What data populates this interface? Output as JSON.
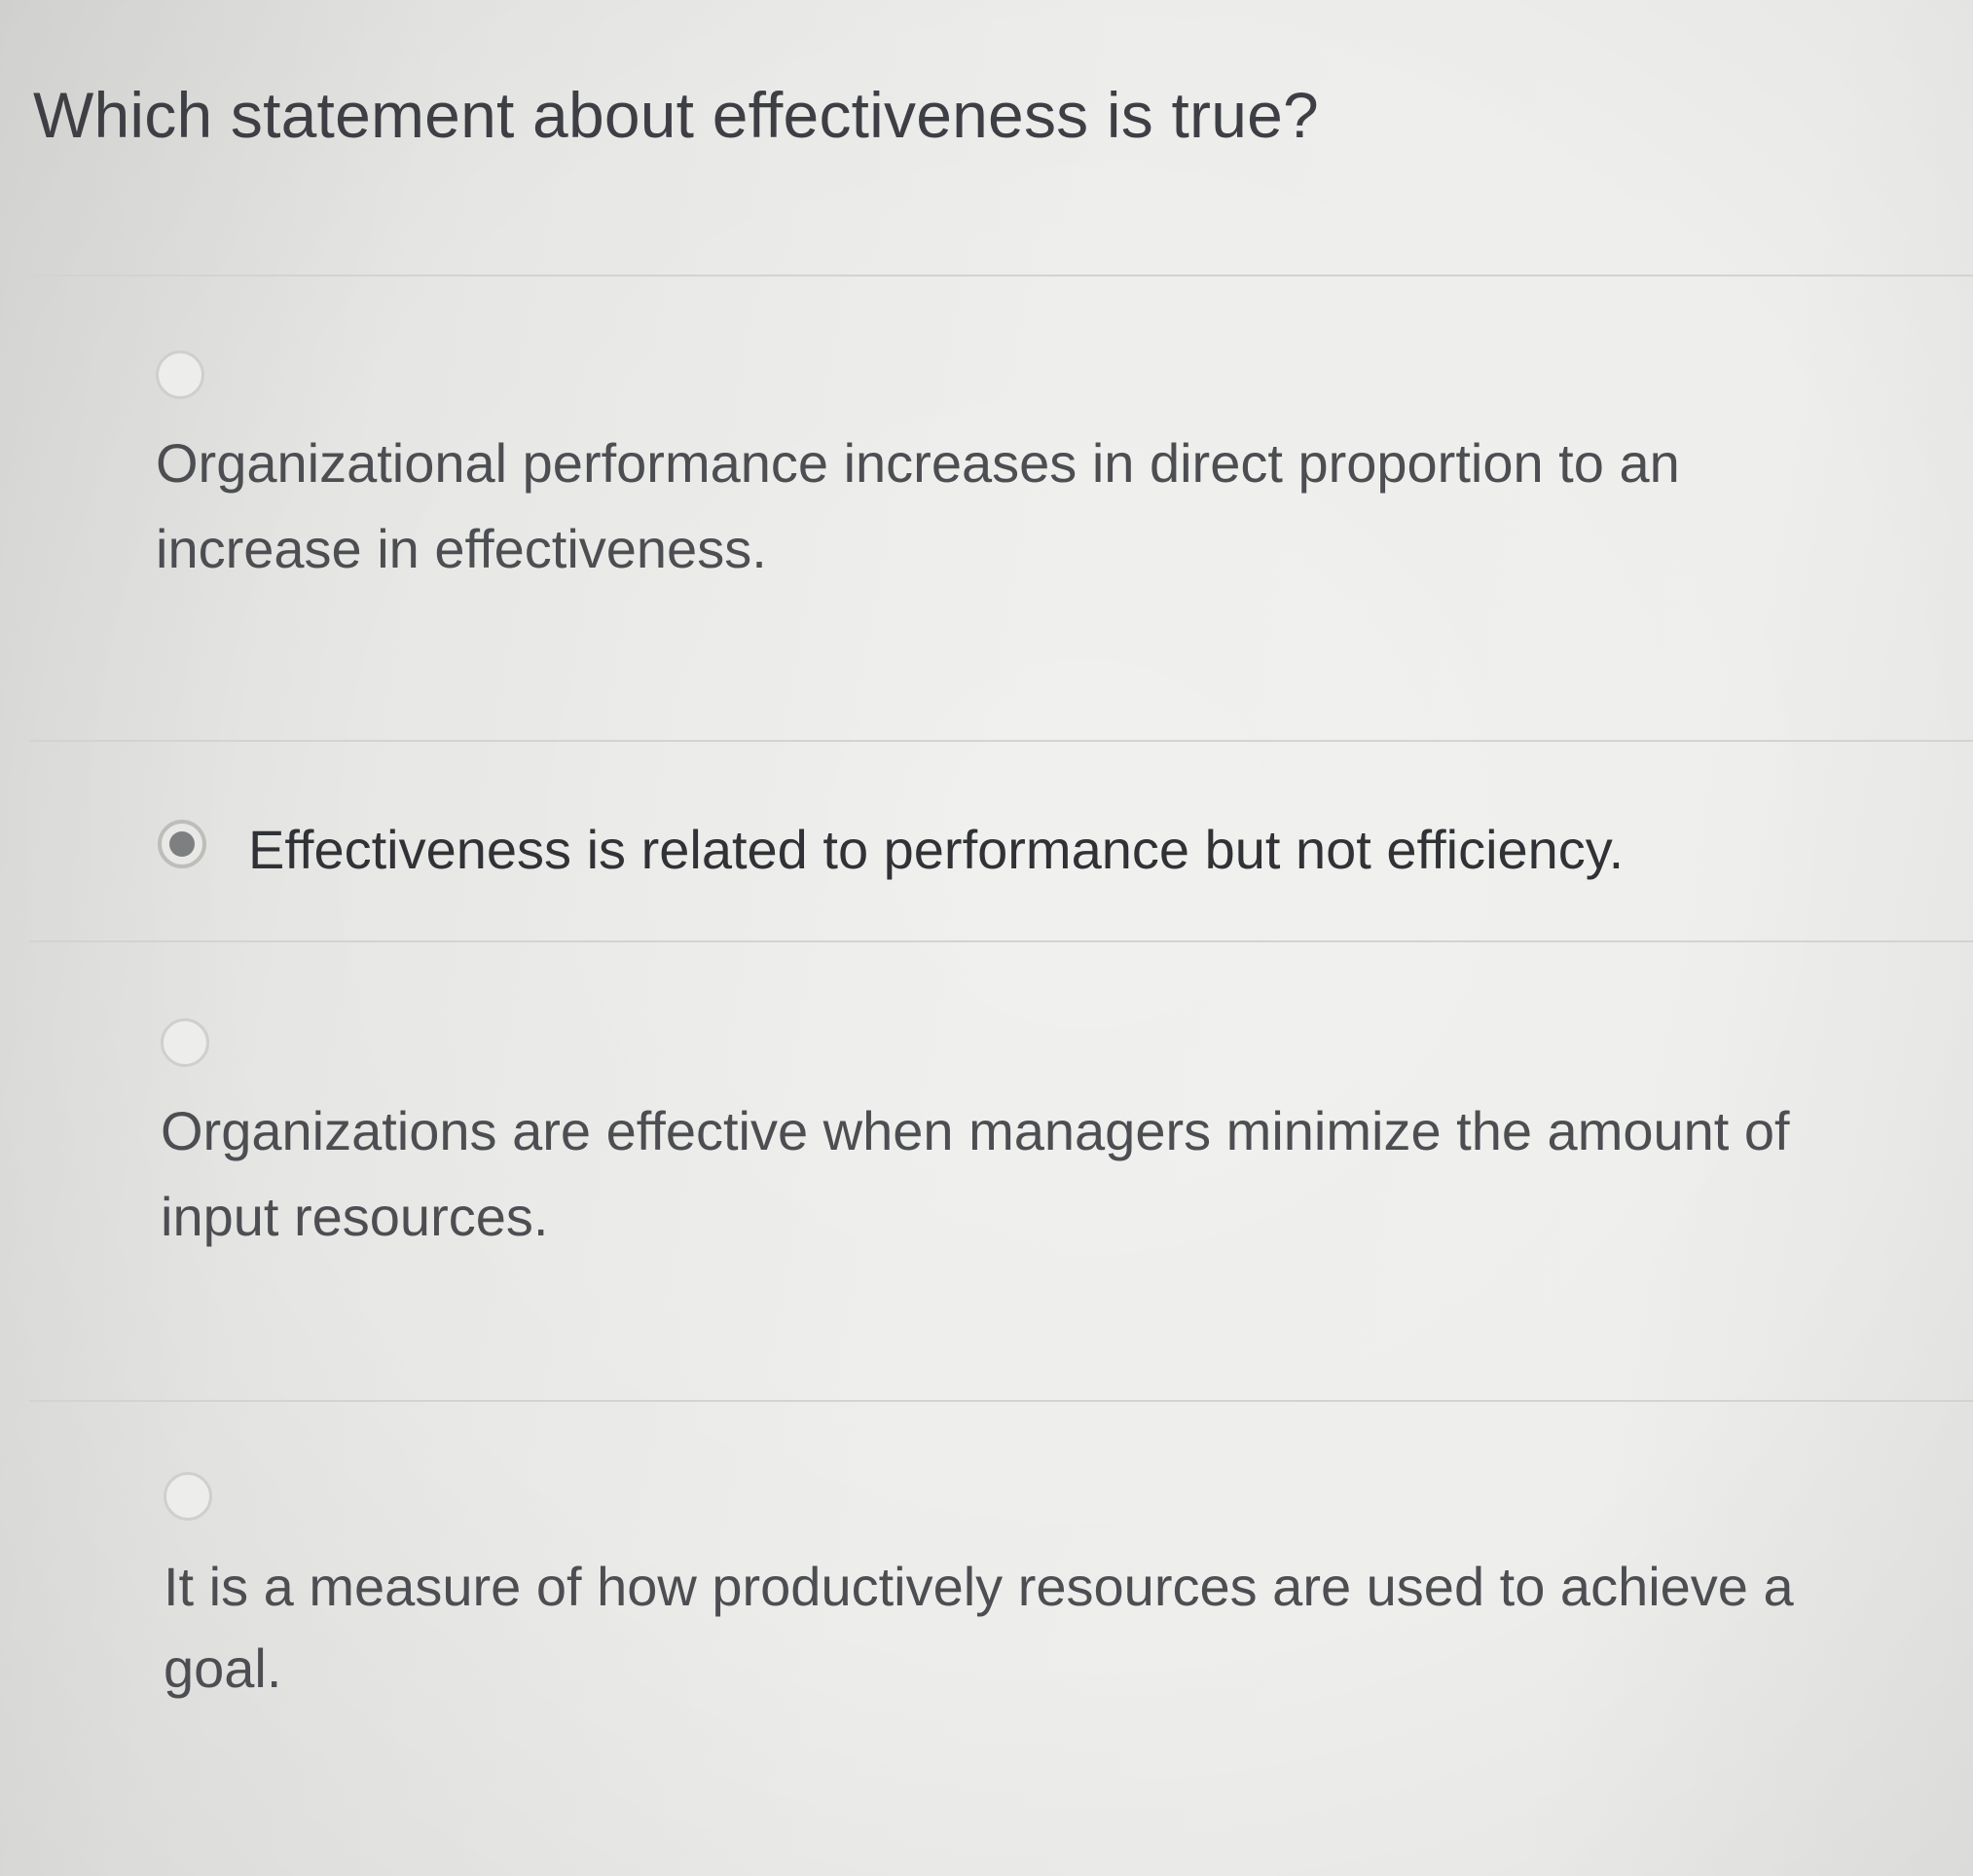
{
  "question": {
    "text": "Which statement about effectiveness is true?"
  },
  "options": [
    {
      "line1": "Organizational performance increases in direct proportion to an",
      "line2": "increase in effectiveness.",
      "selected": false
    },
    {
      "line1": "Effectiveness is related to performance but not efficiency.",
      "selected": true
    },
    {
      "line1": "Organizations are effective when managers minimize the amount of",
      "line2": "input resources.",
      "selected": false
    },
    {
      "line1": "It is a measure of how productively resources are used to achieve a",
      "line2": "goal.",
      "selected": false
    }
  ]
}
